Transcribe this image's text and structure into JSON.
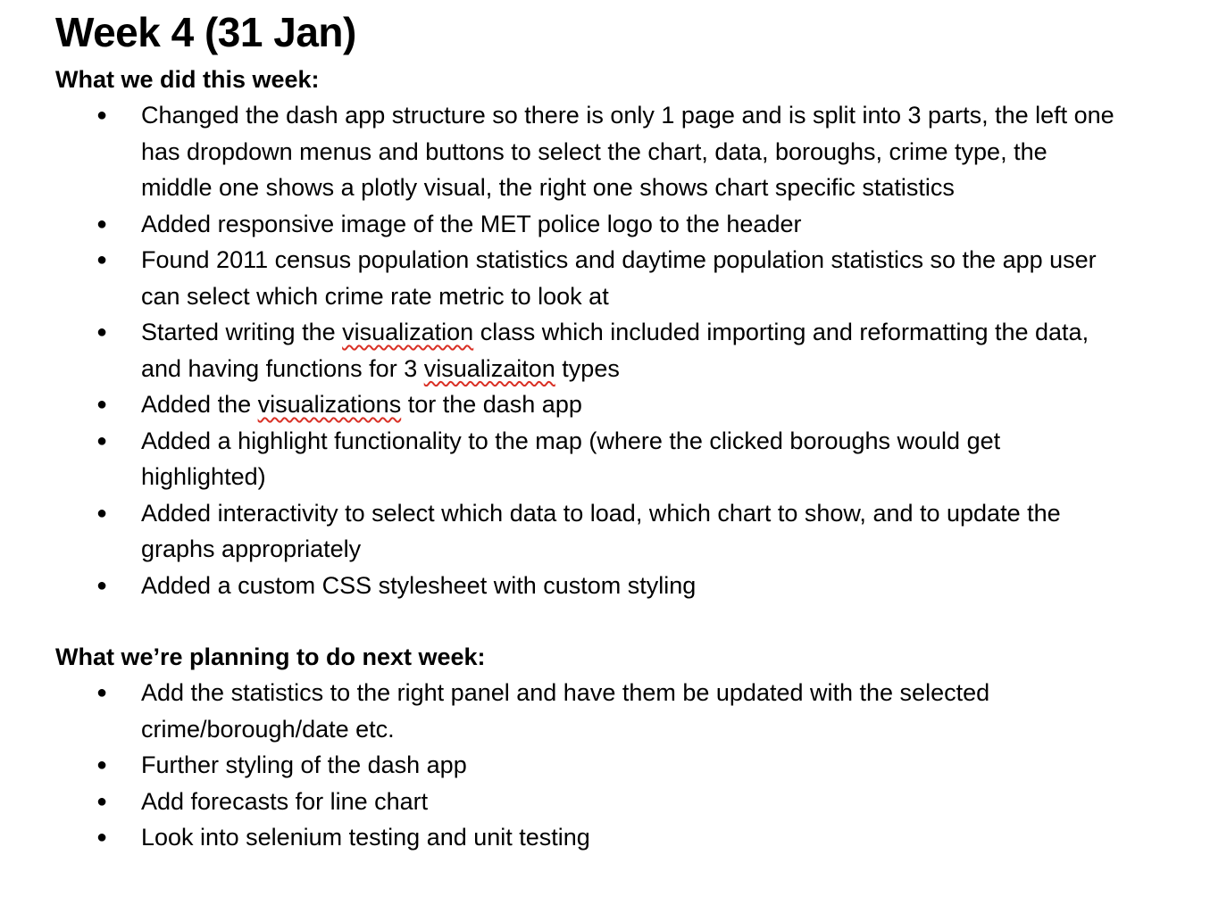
{
  "title": "Week 4 (31 Jan)",
  "done": {
    "heading": "What we did this week:",
    "items": [
      "Changed the dash app structure so there is only 1 page and is split into 3 parts, the left one has dropdown menus and buttons to select the chart, data, boroughs, crime type, the middle one shows a plotly visual, the right one shows chart specific statistics",
      "Added responsive image of the MET police logo to the header",
      "Found 2011 census population statistics and daytime population statistics so the app user can select which crime rate metric to look at",
      {
        "p1": "Started writing the ",
        "w1": "visualization",
        "p2": " class which included importing and reformatting the data, and having functions for 3 ",
        "w2": "visualizaiton",
        "p3": " types"
      },
      {
        "p1": "Added the ",
        "w1": "visualizations",
        "p2": " tor the dash app"
      },
      "Added a highlight functionality to the map (where the clicked boroughs would get highlighted)",
      "Added interactivity to select which data to load, which chart to show, and to update the graphs appropriately",
      "Added a custom CSS stylesheet with custom styling"
    ]
  },
  "next": {
    "heading": "What we’re planning to do next week:",
    "items": [
      "Add the statistics to the right panel and have them be updated with the selected crime/borough/date etc.",
      "Further styling of the dash app",
      "Add forecasts for line chart",
      "Look into selenium testing and unit testing"
    ]
  }
}
